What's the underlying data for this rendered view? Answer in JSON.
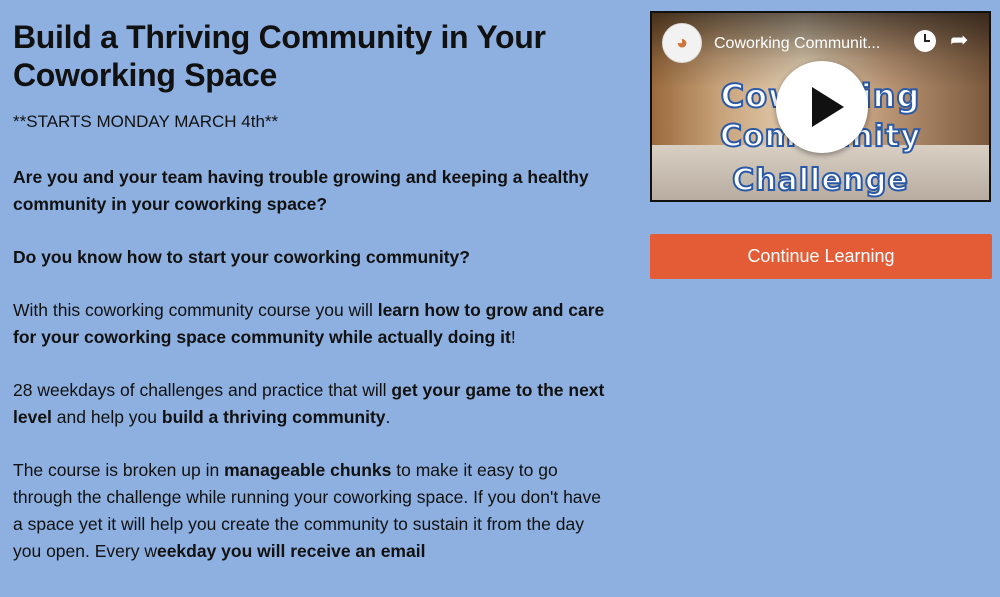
{
  "heading": "Build a Thriving Community in Your Coworking Space",
  "starts": "**STARTS MONDAY MARCH 4th**",
  "p1": "Are you and your team having trouble growing and keeping a healthy community in your coworking space?",
  "p2": "Do you know how to start your coworking community?",
  "p3": {
    "a": "With this coworking community course you will ",
    "b": "learn how to grow and care for your coworking space community while actually doing it",
    "c": "!"
  },
  "p4": {
    "a": "28 weekdays of challenges and practice that will ",
    "b": "get your game to the next level",
    "c": " and help you ",
    "d": "build a thriving community",
    "e": "."
  },
  "p5": {
    "a": "The course is broken up in ",
    "b": "manageable chunks",
    "c": " to make it easy to go through the challenge while running your coworking space. If you don't have a space yet it will help you create the community to sustain it from the day you open. Every w",
    "d": "eekday you will receive an email"
  },
  "video": {
    "title": "Coworking Communit...",
    "overlay_line1": "Coworking",
    "overlay_line2": "Community",
    "overlay_line3": "Challenge",
    "icons": [
      "play-icon",
      "clock-icon",
      "share-icon"
    ]
  },
  "cta_label": "Continue Learning",
  "colors": {
    "background": "#8db0e0",
    "cta": "#e35c36"
  }
}
